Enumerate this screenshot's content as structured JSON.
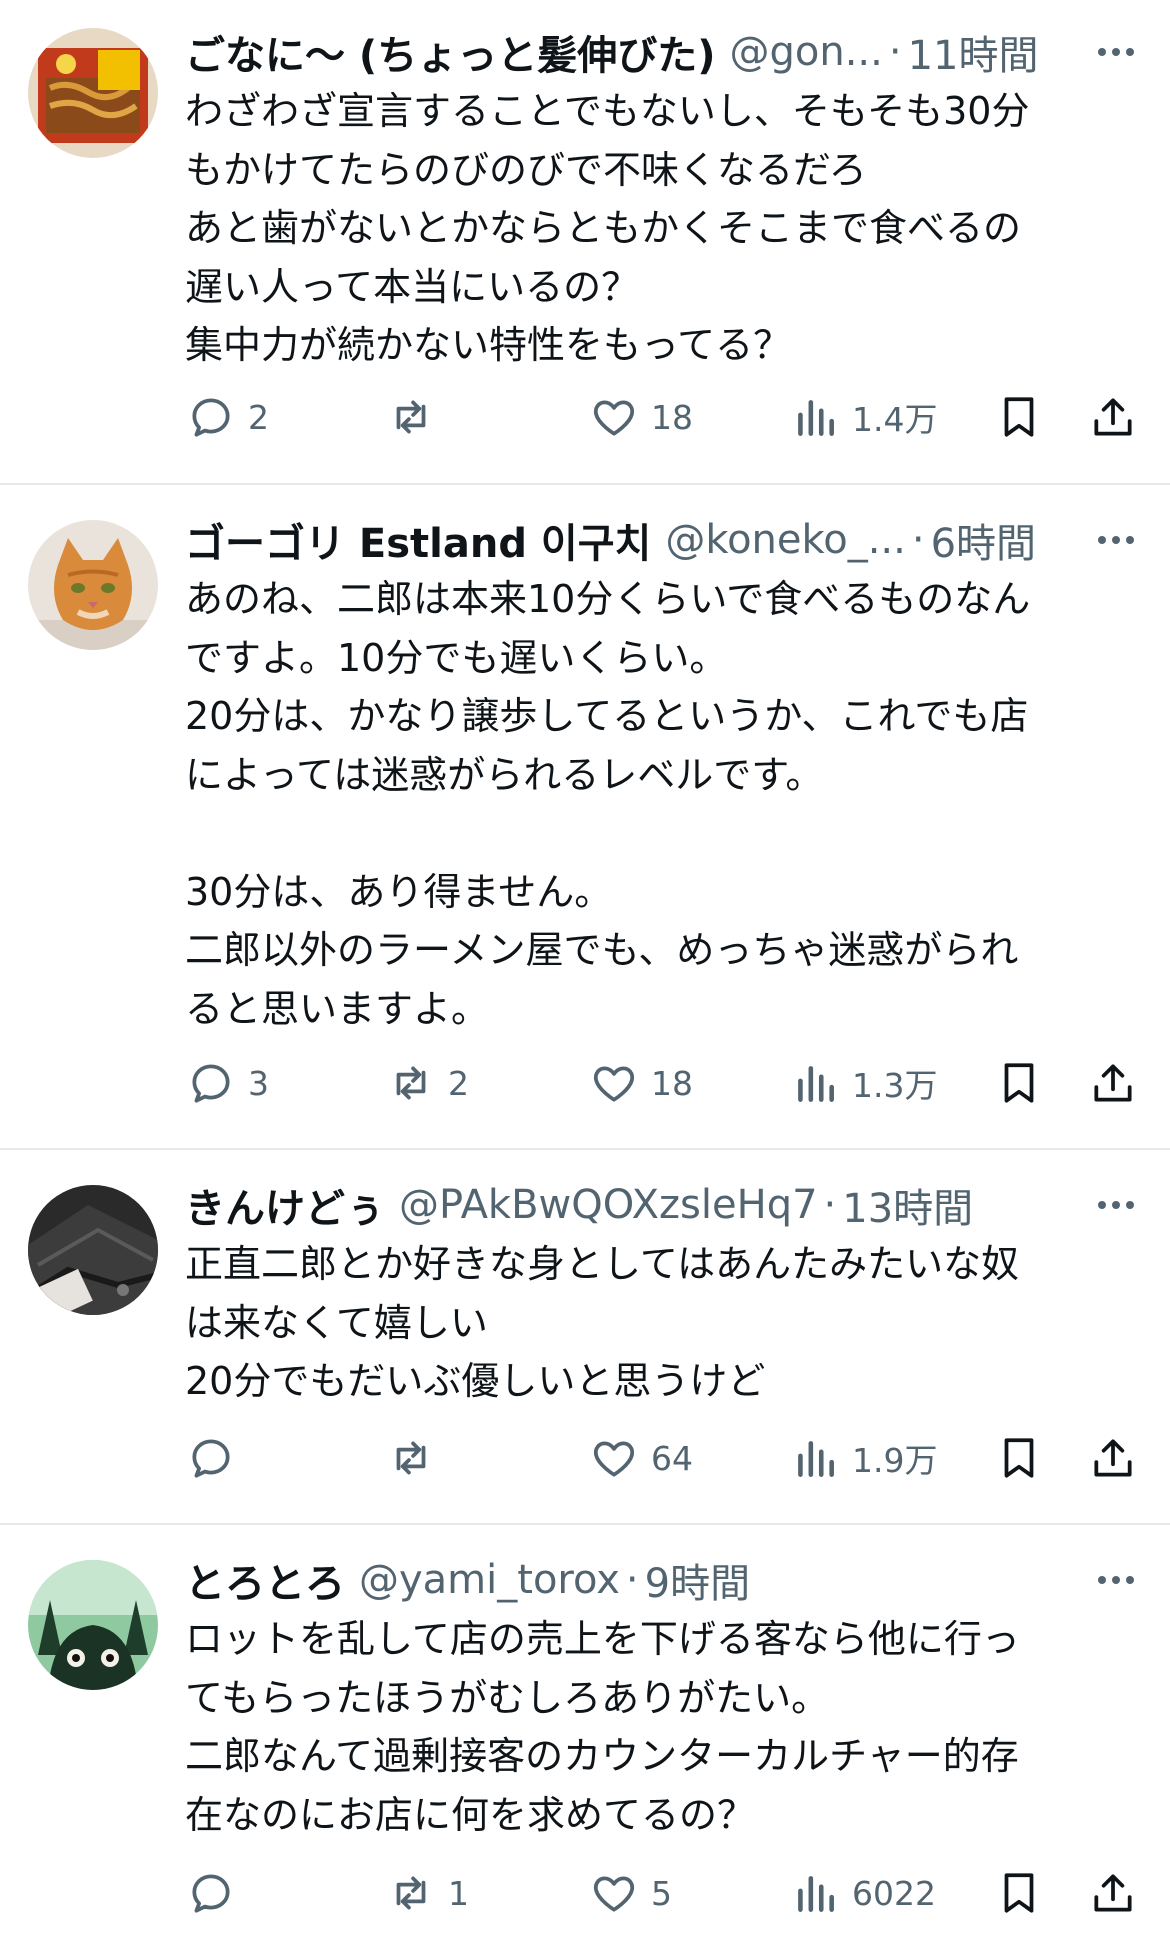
{
  "tweets": [
    {
      "display_name": "ごなに〜 (ちょっと髪伸びた)",
      "handle": "@gon...",
      "time": "11時間",
      "text": "わざわざ宣言することでもないし、そもそも30分\nもかけてたらのびのびで不味くなるだろ\nあと歯がないとかならともかくそこまで食べるの\n遅い人って本当にいるの？\n集中力が続かない特性をもってる？",
      "replies": "2",
      "reposts": "",
      "likes": "18",
      "views": "1.4万",
      "avatar": "yakisoba-package"
    },
    {
      "display_name": "ゴーゴリ Estland 이구치",
      "handle": "@koneko_...",
      "time": "6時間",
      "text": "あのね、二郎は本来10分くらいで食べるものなん\nですよ。10分でも遅いくらい。\n20分は、かなり譲歩してるというか、これでも店\nによっては迷惑がられるレベルです。\n\n30分は、あり得ません。\n二郎以外のラーメン屋でも、めっちゃ迷惑がられ\nると思いますよ。",
      "replies": "3",
      "reposts": "2",
      "likes": "18",
      "views": "1.3万",
      "avatar": "orange-cat"
    },
    {
      "display_name": "きんけどぅ",
      "handle": "@PAkBwQOXzsleHq7",
      "time": "13時間",
      "text": "正直二郎とか好きな身としてはあんたみたいな奴\nは来なくて嬉しい\n20分でもだいぶ優しいと思うけど",
      "replies": "",
      "reposts": "",
      "likes": "64",
      "views": "1.9万",
      "avatar": "leather-bag"
    },
    {
      "display_name": "とろとろ",
      "handle": "@yami_torox",
      "time": "9時間",
      "text": "ロットを乱して店の売上を下げる客なら他に行っ\nてもらったほうがむしろありがたい。\n二郎なんて過剰接客のカウンターカルチャー的存\n在なのにお店に何を求めてるの？",
      "replies": "",
      "reposts": "1",
      "likes": "5",
      "views": "6022",
      "avatar": "forest-creature"
    }
  ],
  "colors": {
    "text": "#0f1419",
    "muted": "#536471",
    "divider": "#e6e9ec"
  },
  "icons": [
    "reply-icon",
    "repost-icon",
    "like-icon",
    "views-icon",
    "bookmark-icon",
    "share-icon",
    "more-icon"
  ]
}
